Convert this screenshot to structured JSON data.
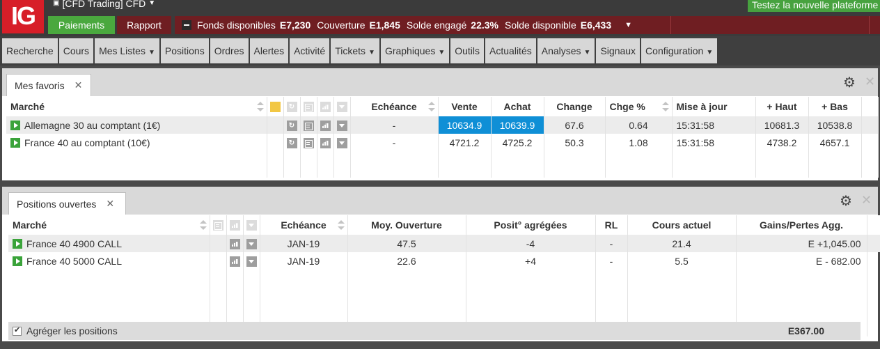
{
  "header": {
    "logo_text": "IG",
    "account_label": "[CFD Trading] CFD",
    "trial_banner": "Testez la nouvelle plateforme",
    "payments_button": "Paiements",
    "report_button": "Rapport",
    "funds": [
      {
        "label": "Fonds disponibles",
        "value": "E7,230"
      },
      {
        "label": "Couverture",
        "value": "E1,845"
      },
      {
        "label": "Solde engagé",
        "value": "22.3%"
      },
      {
        "label": "Solde disponible",
        "value": "E6,433"
      }
    ]
  },
  "menu": [
    {
      "label": "Recherche",
      "dropdown": false
    },
    {
      "label": "Cours",
      "dropdown": false
    },
    {
      "label": "Mes Listes",
      "dropdown": true
    },
    {
      "label": "Positions",
      "dropdown": false
    },
    {
      "label": "Ordres",
      "dropdown": false
    },
    {
      "label": "Alertes",
      "dropdown": false
    },
    {
      "label": "Activité",
      "dropdown": false
    },
    {
      "label": "Tickets",
      "dropdown": true
    },
    {
      "label": "Graphiques",
      "dropdown": true
    },
    {
      "label": "Outils",
      "dropdown": false
    },
    {
      "label": "Actualités",
      "dropdown": false
    },
    {
      "label": "Analyses",
      "dropdown": true
    },
    {
      "label": "Signaux",
      "dropdown": false
    },
    {
      "label": "Configuration",
      "dropdown": true
    }
  ],
  "favorites": {
    "tab_label": "Mes favoris",
    "columns": {
      "market": "Marché",
      "expiry": "Echéance",
      "sell": "Vente",
      "buy": "Achat",
      "change": "Change",
      "change_pct": "Chge %",
      "updated": "Mise à jour",
      "high": "+ Haut",
      "low": "+ Bas"
    },
    "rows": [
      {
        "market": "Allemagne 30 au comptant (1€)",
        "expiry": "-",
        "sell": "10634.9",
        "buy": "10639.9",
        "change": "67.6",
        "change_pct": "0.64",
        "updated": "15:31:58",
        "high": "10681.3",
        "low": "10538.8"
      },
      {
        "market": "France 40 au comptant (10€)",
        "expiry": "-",
        "sell": "4721.2",
        "buy": "4725.2",
        "change": "50.3",
        "change_pct": "1.08",
        "updated": "15:31:58",
        "high": "4738.2",
        "low": "4657.1"
      }
    ]
  },
  "positions": {
    "tab_label": "Positions ouvertes",
    "columns": {
      "market": "Marché",
      "expiry": "Echéance",
      "avg_open": "Moy. Ouverture",
      "aggregated": "Posit° agrégées",
      "rl": "RL",
      "current": "Cours actuel",
      "pnl": "Gains/Pertes Agg."
    },
    "rows": [
      {
        "market": "France 40 4900 CALL",
        "expiry": "JAN-19",
        "avg_open": "47.5",
        "aggregated": "-4",
        "rl": "-",
        "current": "21.4",
        "pnl": "E +1,045.00"
      },
      {
        "market": "France 40 5000 CALL",
        "expiry": "JAN-19",
        "avg_open": "22.6",
        "aggregated": "+4",
        "rl": "-",
        "current": "5.5",
        "pnl": "E - 682.00"
      }
    ],
    "aggregate_label": "Agréger les positions",
    "total": "E367.00"
  },
  "colors": {
    "brand_red": "#d71e28",
    "green": "#4aa83e",
    "maroon": "#6f1e22",
    "negative": "#c9252c",
    "positive": "#1a88c9",
    "highlight": "#0f8fd6"
  }
}
